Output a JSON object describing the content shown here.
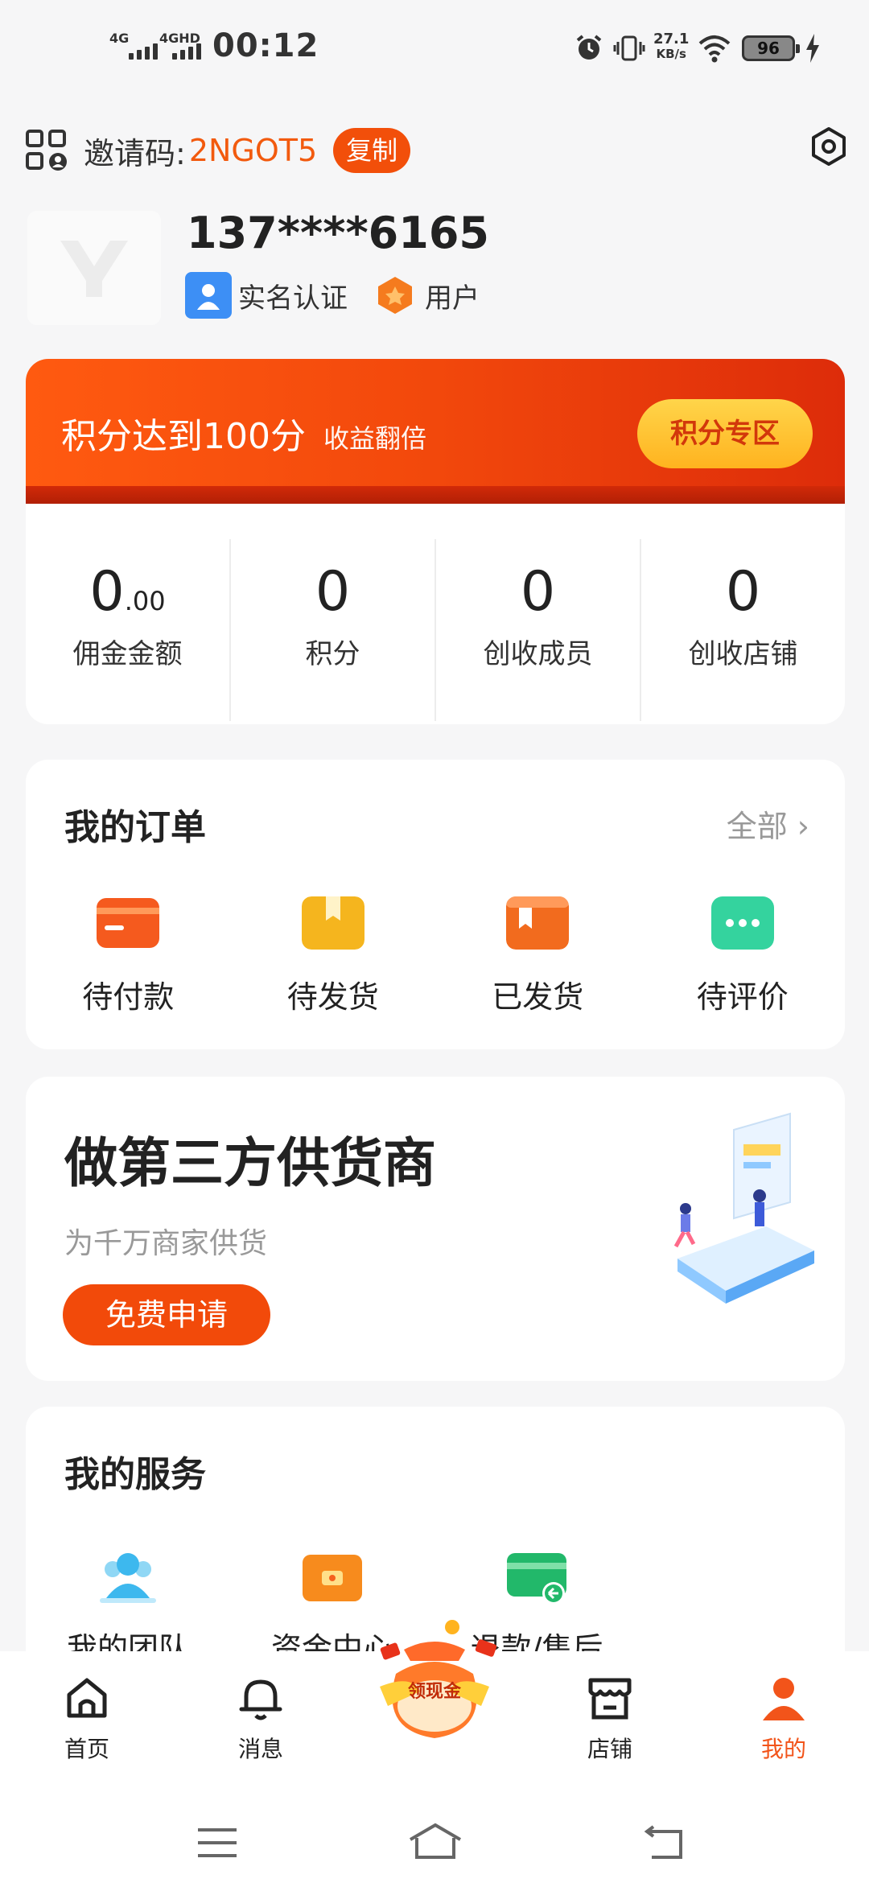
{
  "status_bar": {
    "net1": "4G",
    "net2": "4GHD",
    "time": "00:12",
    "speed_value": "27.1",
    "speed_unit": "KB/s",
    "battery": "96"
  },
  "header": {
    "invite_label": "邀请码:",
    "invite_code": "2NGOT5",
    "copy_label": "复制",
    "phone": "137****6165",
    "badges": [
      "实名认证",
      "用户"
    ]
  },
  "points_banner": {
    "title": "积分达到100分",
    "subtitle": "收益翻倍",
    "button": "积分专区"
  },
  "stats": [
    {
      "value": "0",
      "decimal": ".00",
      "label": "佣金金额"
    },
    {
      "value": "0",
      "decimal": "",
      "label": "积分"
    },
    {
      "value": "0",
      "decimal": "",
      "label": "创收成员"
    },
    {
      "value": "0",
      "decimal": "",
      "label": "创收店铺"
    }
  ],
  "orders": {
    "title": "我的订单",
    "all_link": "全部 ›",
    "items": [
      {
        "label": "待付款",
        "icon": "card-icon",
        "color": "#f5601e"
      },
      {
        "label": "待发货",
        "icon": "bookmark-box-icon",
        "color": "#f5b51e"
      },
      {
        "label": "已发货",
        "icon": "package-icon",
        "color": "#f26b1e"
      },
      {
        "label": "待评价",
        "icon": "chat-dots-icon",
        "color": "#34d39e"
      }
    ]
  },
  "supplier": {
    "title": "做第三方供货商",
    "subtitle": "为千万商家供货",
    "button": "免费申请"
  },
  "services": {
    "title": "我的服务",
    "items": [
      {
        "label": "我的团队",
        "icon": "team-icon"
      },
      {
        "label": "资金中心",
        "icon": "wallet-icon"
      },
      {
        "label": "退款/售后",
        "icon": "refund-icon"
      }
    ]
  },
  "bottom_nav": {
    "items": [
      "首页",
      "消息",
      "店铺",
      "我的"
    ],
    "center_label": "领现金",
    "accent": "#f2541a"
  }
}
